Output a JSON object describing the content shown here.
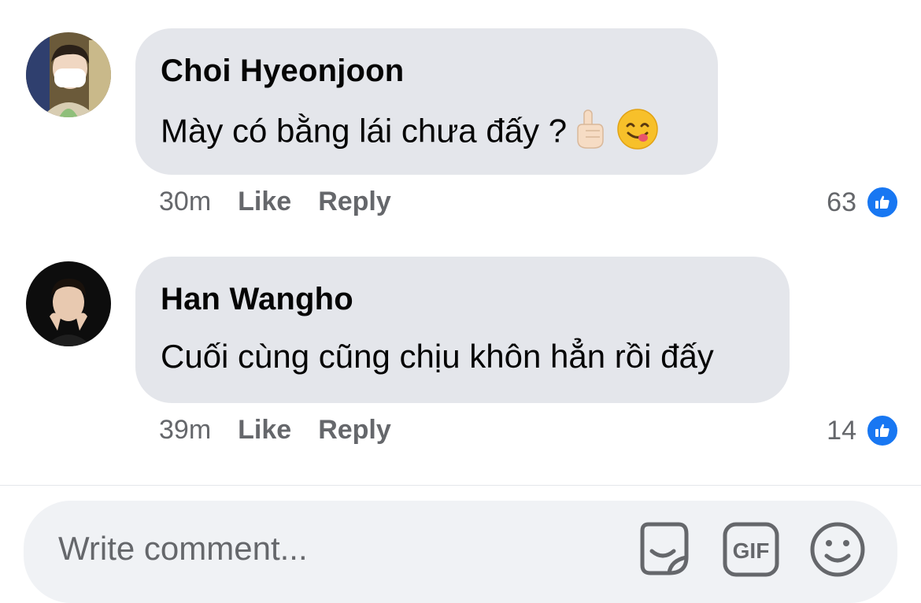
{
  "comments": [
    {
      "author": "Choi Hyeonjoon",
      "text": "Mày có bằng lái chưa đấy ?",
      "emoji": [
        "pointing-up-hand-emoji",
        "yum-face-emoji"
      ],
      "time": "30m",
      "like_label": "Like",
      "reply_label": "Reply",
      "reaction_count": "63"
    },
    {
      "author": "Han Wangho",
      "text": "Cuối cùng cũng chịu khôn hẳn rồi đấy",
      "time": "39m",
      "like_label": "Like",
      "reply_label": "Reply",
      "reaction_count": "14"
    }
  ],
  "composer": {
    "placeholder": "Write comment...",
    "icons": [
      "sticker-icon",
      "gif-icon",
      "emoji-icon"
    ],
    "gif_label": "GIF"
  },
  "colors": {
    "bubble": "#e4e6eb",
    "meta_text": "#65676b",
    "like_blue": "#1877f2",
    "composer_bg": "#f0f2f5"
  }
}
